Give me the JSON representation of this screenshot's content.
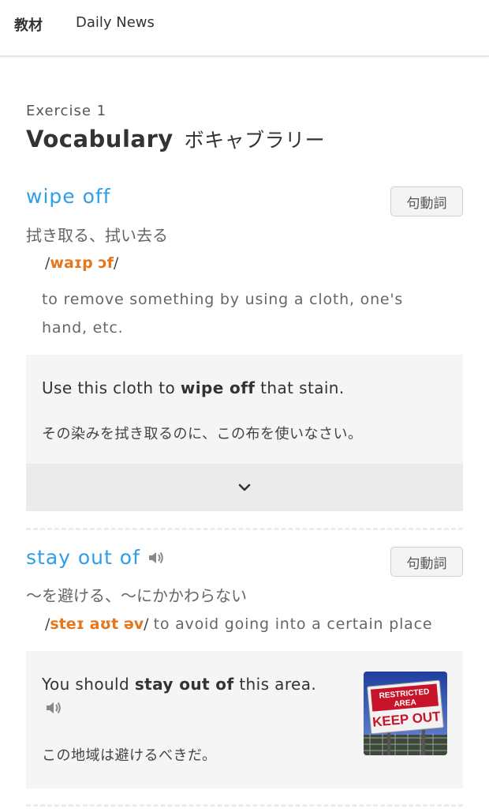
{
  "nav": {
    "tabs": [
      {
        "label": "教材"
      },
      {
        "label": "Daily News"
      }
    ]
  },
  "exercise": {
    "label": "Exercise 1",
    "title": "Vocabulary",
    "title_jp": "ボキャブラリー"
  },
  "entries": [
    {
      "headword": "wipe off",
      "pos": "句動詞",
      "meaning_jp": "拭き取る、拭い去る",
      "ipa": "waɪp ɔf",
      "definition": "to remove something by using a cloth, one's hand, etc.",
      "example": {
        "before": "Use this cloth to ",
        "bold": "wipe off",
        "after": " that stain.",
        "jp": "その染みを拭き取るのに、この布を使いなさい。"
      }
    },
    {
      "headword": "stay out of",
      "pos": "句動詞",
      "meaning_jp": "〜を避ける、〜にかかわらない",
      "ipa": "steɪ aʊt əv",
      "definition": "to avoid going into a certain place",
      "example": {
        "before": "You should ",
        "bold": "stay out of",
        "after": " this area.",
        "jp": "この地域は避けるべきだ。",
        "image_sign_line1": "RESTRICTED",
        "image_sign_line2": "AREA",
        "image_sign_line3": "KEEP OUT"
      }
    }
  ],
  "icons": {
    "speaker": "speaker-icon",
    "expand": "chevron-down-icon"
  },
  "colors": {
    "headword": "#2f9ee8",
    "ipa": "#e6761c",
    "example_bg": "#f5f5f5"
  }
}
